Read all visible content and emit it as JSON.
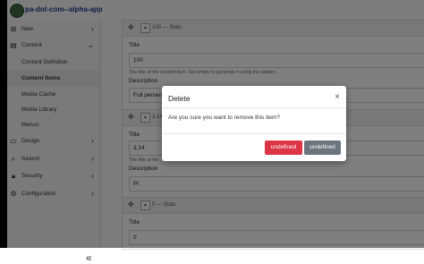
{
  "app": {
    "name": "pa-dot-com--alpha-app"
  },
  "sidebar": {
    "items": [
      {
        "label": "New",
        "icon": "plus-square-icon",
        "chevron": "›"
      },
      {
        "label": "Content",
        "icon": "content-icon",
        "chevron": "⌄"
      },
      {
        "label": "Content Definition"
      },
      {
        "label": "Content Items"
      },
      {
        "label": "Media Cache"
      },
      {
        "label": "Media Library"
      },
      {
        "label": "Menus"
      },
      {
        "label": "Design",
        "icon": "monitor-icon",
        "chevron": "›"
      },
      {
        "label": "Search",
        "icon": "search-icon",
        "chevron": "›"
      },
      {
        "label": "Security",
        "icon": "lock-icon",
        "chevron": "›"
      },
      {
        "label": "Configuration",
        "icon": "gear-icon",
        "chevron": "›"
      }
    ],
    "collapse_label": "«"
  },
  "cards": [
    {
      "header": "100 — Stats",
      "title_label": "Title",
      "title_value": "100",
      "help": "The title of the content item. Set empty to generate it using the pattern.",
      "description_label": "Description",
      "description_value": "Full percent"
    },
    {
      "header": "3.14",
      "title_label": "Title",
      "title_value": "3.14",
      "help": "The title of the",
      "description_label": "Description",
      "description_value": "Pi"
    },
    {
      "header": "0 — Stats",
      "title_label": "Title",
      "title_value": "0"
    }
  ],
  "modal": {
    "title": "Delete",
    "close": "×",
    "body": "Are you sure you want to remove this item?",
    "confirm_label": "undefined",
    "cancel_label": "undefined",
    "colors": {
      "danger": "#dc3545",
      "secondary": "#6c757d"
    }
  }
}
